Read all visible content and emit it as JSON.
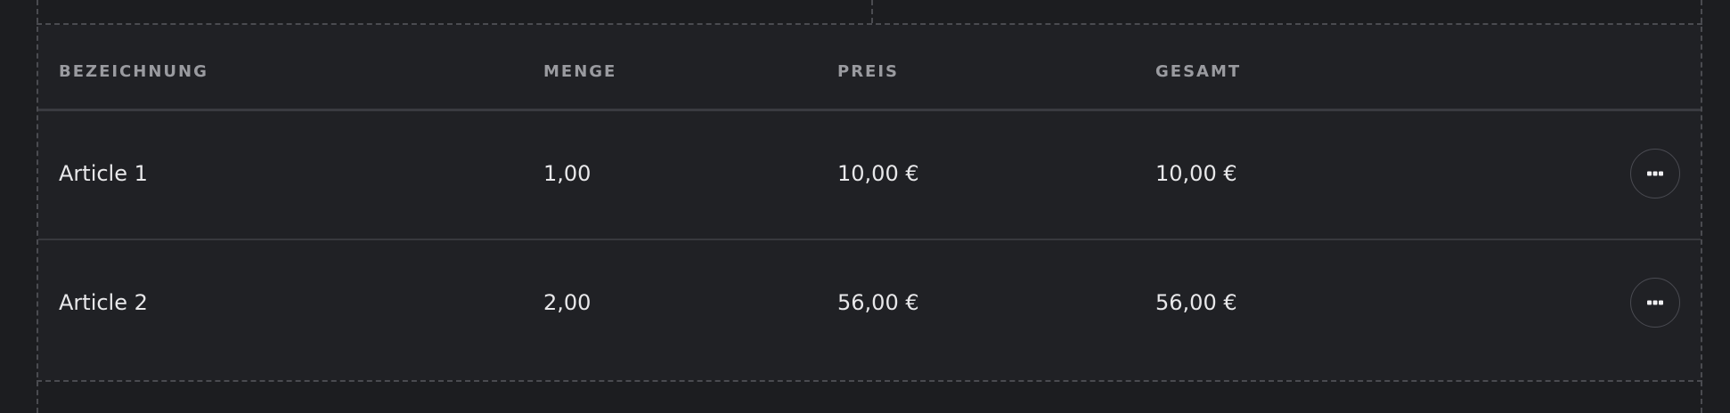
{
  "table": {
    "columns": [
      "BEZEICHNUNG",
      "MENGE",
      "PREIS",
      "GESAMT"
    ],
    "rows": [
      {
        "name": "Article 1",
        "quantity": "1,00",
        "price": "10,00 €",
        "total": "10,00 €",
        "actions_icon": "more-horizontal-icon"
      },
      {
        "name": "Article 2",
        "quantity": "2,00",
        "price": "56,00 €",
        "total": "56,00 €",
        "actions_icon": "more-horizontal-icon"
      }
    ]
  },
  "colors": {
    "background": "#1c1d20",
    "table_background": "#202125",
    "header_text": "#9a9ba0",
    "cell_text": "#e8e8ea",
    "divider": "#3a3b40",
    "guide_dashes": "#4a4b50"
  }
}
